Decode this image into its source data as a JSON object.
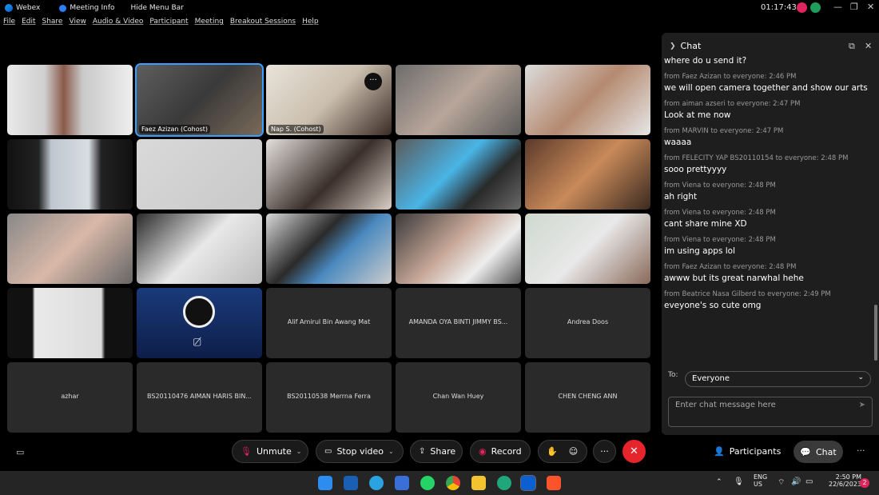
{
  "titlebar": {
    "app": "Webex",
    "meeting_info": "Meeting Info",
    "hide_menu": "Hide Menu Bar",
    "clock": "01:17:43"
  },
  "menu": [
    "File",
    "Edit",
    "Share",
    "View",
    "Audio & Video",
    "Participant",
    "Meeting",
    "Breakout Sessions",
    "Help"
  ],
  "video_tiles": {
    "faez": "Faez Azizan (Cohost)",
    "nap": "Nap S. (Cohost)"
  },
  "name_tiles": {
    "alif": "Alif Amirul Bin Awang Mat",
    "amanda": "AMANDA OYA BINTI JIMMY BS...",
    "andrea": "Andrea Doos",
    "azhar": "azhar",
    "aiman": "BS20110476 AIMAN HARIS BIN...",
    "merrna": "BS20110538 Merrna Ferra",
    "chan": "Chan Wan Huey",
    "chen": "CHEN CHENG ANN"
  },
  "controls": {
    "unmute": "Unmute",
    "stop_video": "Stop video",
    "share": "Share",
    "record": "Record",
    "participants": "Participants",
    "chat": "Chat"
  },
  "chat": {
    "title": "Chat",
    "partial": "where do u send it?",
    "messages": [
      {
        "from": "from Faez Azizan to everyone:   2:46 PM",
        "text": "we will open camera together and show our arts"
      },
      {
        "from": "from aiman azseri to everyone:   2:47 PM",
        "text": "Look at me now"
      },
      {
        "from": "from MARVIN to everyone:   2:47 PM",
        "text": "waaaa"
      },
      {
        "from": "from FELECITY YAP BS20110154 to everyone:   2:48 PM",
        "text": "sooo prettyyyy"
      },
      {
        "from": "from Viena to everyone:   2:48 PM",
        "text": "ah right"
      },
      {
        "from": "from Viena to everyone:   2:48 PM",
        "text": "cant share mine XD"
      },
      {
        "from": "from Viena to everyone:   2:48 PM",
        "text": "im using apps lol"
      },
      {
        "from": "from Faez Azizan to everyone:   2:48 PM",
        "text": "awww but its great narwhal hehe"
      },
      {
        "from": "from Beatrice Nasa Gilberd to everyone:   2:49 PM",
        "text": "eveyone's so cute omg"
      }
    ],
    "to_label": "To:",
    "to_value": "Everyone",
    "input_placeholder": "Enter chat message here"
  },
  "taskbar": {
    "lang": "ENG",
    "region": "US",
    "time": "2:50 PM",
    "date": "22/6/2023",
    "badge": "2"
  }
}
